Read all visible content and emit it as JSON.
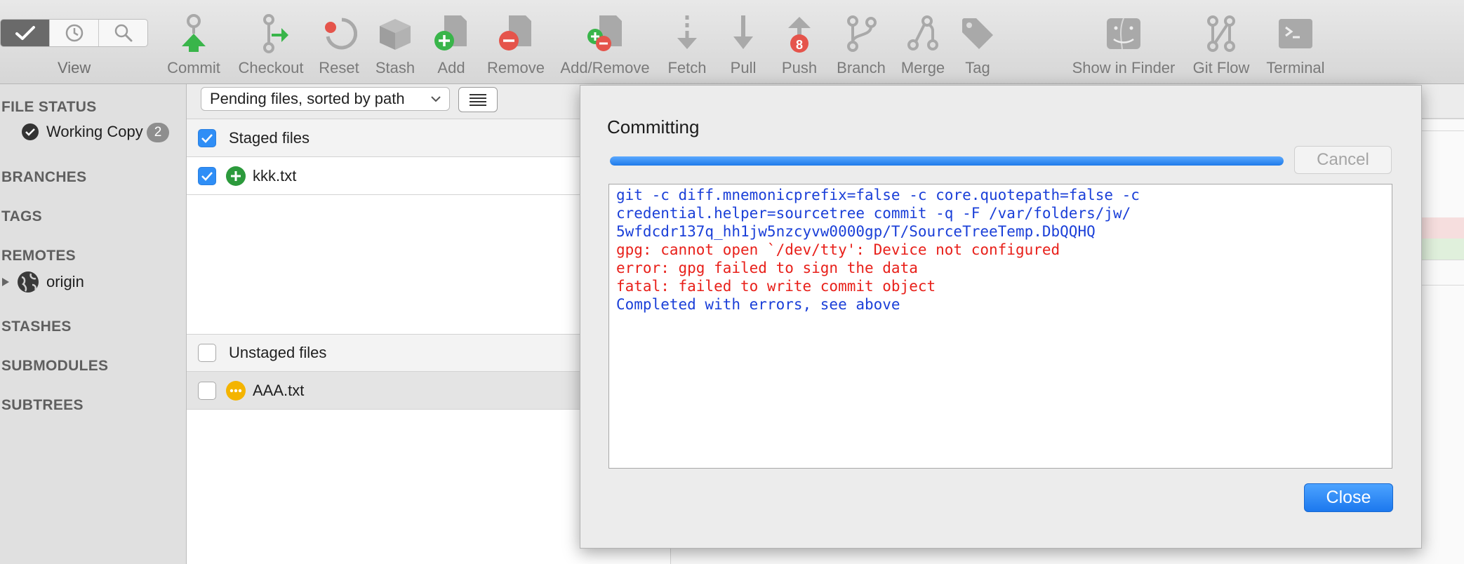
{
  "toolbar": {
    "view_label": "View",
    "items": [
      {
        "label": "Commit",
        "icon": "commit-icon"
      },
      {
        "label": "Checkout",
        "icon": "checkout-icon"
      },
      {
        "label": "Reset",
        "icon": "reset-icon"
      },
      {
        "label": "Stash",
        "icon": "stash-icon"
      },
      {
        "label": "Add",
        "icon": "add-icon"
      },
      {
        "label": "Remove",
        "icon": "remove-icon"
      },
      {
        "label": "Add/Remove",
        "icon": "add-remove-icon"
      },
      {
        "label": "Fetch",
        "icon": "fetch-icon"
      },
      {
        "label": "Pull",
        "icon": "pull-icon"
      },
      {
        "label": "Push",
        "icon": "push-icon",
        "badge": "8"
      },
      {
        "label": "Branch",
        "icon": "branch-icon"
      },
      {
        "label": "Merge",
        "icon": "merge-icon"
      },
      {
        "label": "Tag",
        "icon": "tag-icon"
      },
      {
        "label": "Show in Finder",
        "icon": "finder-icon"
      },
      {
        "label": "Git Flow",
        "icon": "git-flow-icon"
      },
      {
        "label": "Terminal",
        "icon": "terminal-icon"
      }
    ]
  },
  "sidebar": {
    "file_status": "FILE STATUS",
    "working_copy": "Working Copy",
    "working_copy_count": "2",
    "branches": "BRANCHES",
    "tags": "TAGS",
    "remotes": "REMOTES",
    "origin": "origin",
    "stashes": "STASHES",
    "submodules": "SUBMODULES",
    "subtrees": "SUBTREES"
  },
  "filter": {
    "selected": "Pending files, sorted by path"
  },
  "files": {
    "staged_header": "Staged files",
    "staged": [
      {
        "name": "kkk.txt",
        "status": "added"
      }
    ],
    "unstaged_header": "Unstaged files",
    "unstaged": [
      {
        "name": "AAA.txt",
        "status": "modified"
      }
    ]
  },
  "modal": {
    "title": "Committing",
    "progress": 1.0,
    "cancel_label": "Cancel",
    "close_label": "Close",
    "log": [
      {
        "text": "git -c diff.mnemonicprefix=false -c core.quotepath=false -c",
        "kind": "info"
      },
      {
        "text": "credential.helper=sourcetree commit -q -F /var/folders/jw/",
        "kind": "info"
      },
      {
        "text": "5wfdcdr137q_hh1jw5nzcyvw0000gp/T/SourceTreeTemp.DbQQHQ",
        "kind": "info"
      },
      {
        "text": "gpg: cannot open `/dev/tty': Device not configured",
        "kind": "error"
      },
      {
        "text": "error: gpg failed to sign the data",
        "kind": "error"
      },
      {
        "text": "fatal: failed to write commit object",
        "kind": "error"
      },
      {
        "text": "Completed with errors, see above",
        "kind": "info"
      }
    ]
  },
  "colors": {
    "info": "#1a3fd8",
    "error": "#e8201a",
    "accent": "#2f8ef6"
  }
}
